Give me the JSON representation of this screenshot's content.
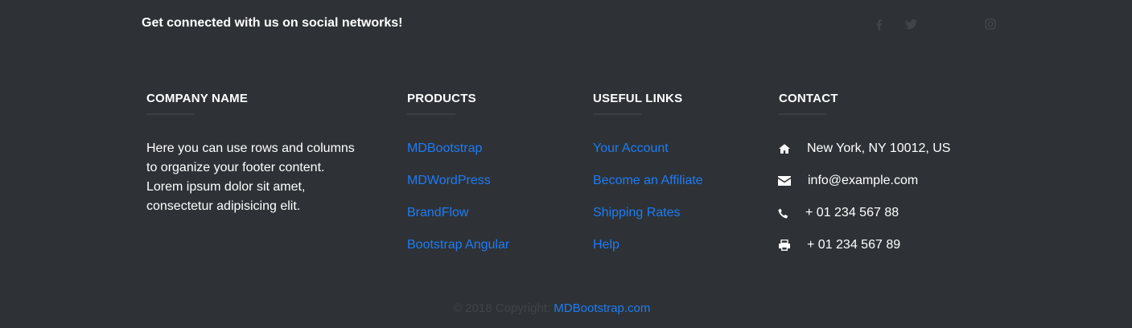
{
  "social_bar": {
    "title": "Get connected with us on social networks!",
    "icons": [
      "facebook-icon",
      "twitter-icon",
      "instagram-icon"
    ]
  },
  "columns": {
    "company": {
      "heading": "Company name",
      "description": "Here you can use rows and columns to organize your footer content. Lorem ipsum dolor sit amet, consectetur adipisicing elit."
    },
    "products": {
      "heading": "Products",
      "links": [
        "MDBootstrap",
        "MDWordPress",
        "BrandFlow",
        "Bootstrap Angular"
      ]
    },
    "useful_links": {
      "heading": "Useful links",
      "links": [
        "Your Account",
        "Become an Affiliate",
        "Shipping Rates",
        "Help"
      ]
    },
    "contact": {
      "heading": "Contact",
      "items": [
        {
          "icon": "home-icon",
          "text": "New York, NY 10012, US"
        },
        {
          "icon": "envelope-icon",
          "text": "info@example.com"
        },
        {
          "icon": "phone-icon",
          "text": "+ 01 234 567 88"
        },
        {
          "icon": "print-icon",
          "text": "+ 01 234 567 89"
        }
      ]
    }
  },
  "copyright": {
    "prefix": "© 2018 Copyright:",
    "link_text": "MDBootstrap.com"
  },
  "colors": {
    "background": "#2e3236",
    "link": "#1e7bf4",
    "text": "#ffffff",
    "muted": "#3f4448"
  }
}
